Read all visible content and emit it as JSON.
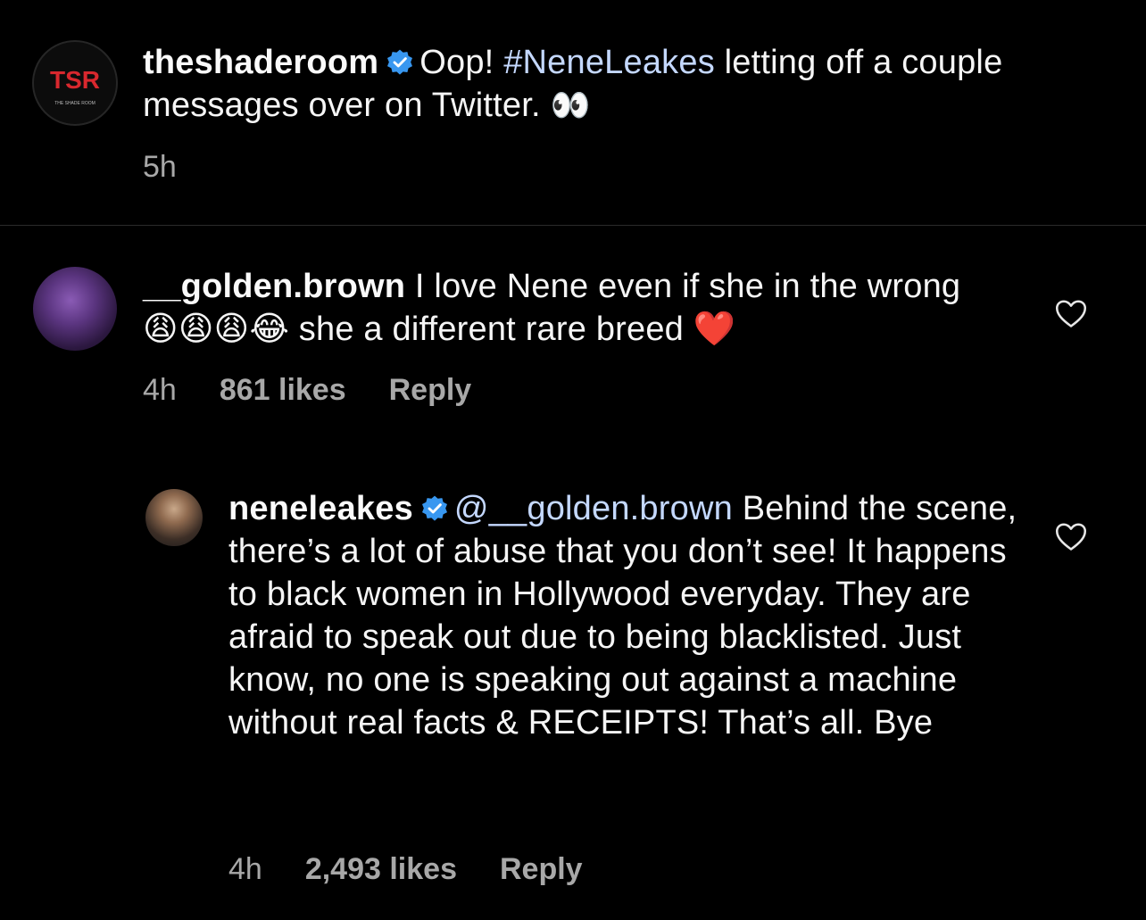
{
  "caption": {
    "username": "theshaderoom",
    "text_before": "Oop! ",
    "hashtag": "#NeneLeakes",
    "text_after": " letting off a couple messages over on Twitter. ",
    "emoji": "👀",
    "time": "5h",
    "avatar_label": "TSR",
    "avatar_sub": "THE SHADE ROOM"
  },
  "comments": [
    {
      "username": "__golden.brown",
      "text": "I love Nene even if she in the wrong 😩😩😩😂 she a different rare breed ❤️",
      "time": "4h",
      "likes": "861 likes",
      "reply": "Reply"
    },
    {
      "username": "neneleakes",
      "mention": "@__golden.brown",
      "text": " Behind the scene, there’s a lot of abuse that you don’t see! It happens to black women in Hollywood everyday. They are afraid to speak out due to being blacklisted. Just know, no one is speaking out against a machine without real facts & RECEIPTS! That’s all. Bye",
      "time": "4h",
      "likes": "2,493 likes",
      "reply": "Reply"
    }
  ],
  "colors": {
    "background": "#000000",
    "hashtag": "#c4d8ff",
    "meta": "#a8a8a8",
    "verified": "#3897f0"
  }
}
